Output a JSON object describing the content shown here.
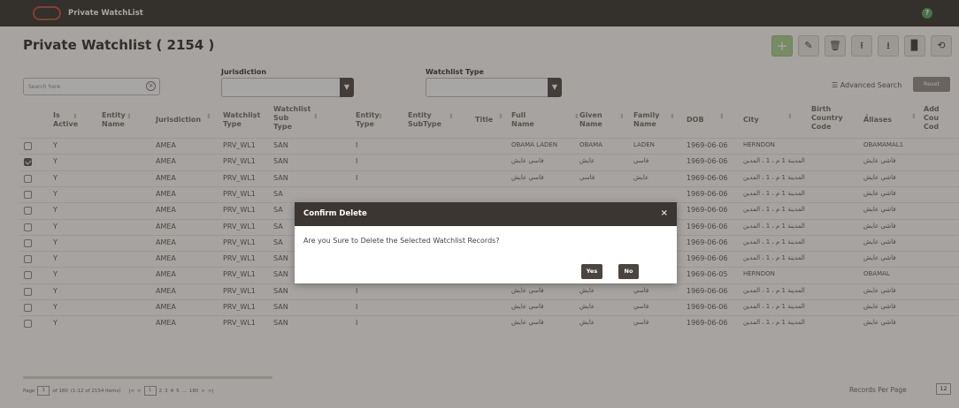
{
  "app": {
    "title": "Private WatchList",
    "help": "?"
  },
  "page": {
    "title": "Private Watchlist ( 2154 )"
  },
  "toolbar": {
    "add": "+",
    "edit": "✎",
    "delete": "🗑",
    "upload": "⭱",
    "download": "⭳",
    "file": "▉",
    "refresh": "⟲"
  },
  "filters": {
    "search_placeholder": "Search here",
    "jurisdiction_label": "Jurisdiction",
    "watchlist_type_label": "Watchlist Type",
    "advanced_search": "Advanced Search",
    "reset": "Reset"
  },
  "columns": [
    "Is Active",
    "Entity Name",
    "Jurisdiction",
    "Watchlist Type",
    "Watchlist Sub Type",
    "Entity Type",
    "Entity SubType",
    "Title",
    "Full Name",
    "Given Name",
    "Family Name",
    "DOB",
    "City",
    "Birth Country Code",
    "Aliases",
    "Add Cou Cod"
  ],
  "rows": [
    {
      "checked": false,
      "active": "Y",
      "jur": "AMEA",
      "wtype": "PRV_WL1",
      "wsub": "SAN",
      "etype": "I",
      "full": "OBAMA LADEN",
      "given": "OBAMA",
      "family": "LADEN",
      "dob": "1969-06-06",
      "city": "HERNDON",
      "alias": "OBAMAMAL1"
    },
    {
      "checked": true,
      "active": "Y",
      "jur": "AMEA",
      "wtype": "PRV_WL1",
      "wsub": "SAN",
      "etype": "I",
      "full": "فاسي عايش",
      "given": "عايش",
      "family": "فاسي",
      "dob": "1969-06-06",
      "city": "المدينة 1 م ، 1 ، المدين",
      "alias": "فاشي عايش"
    },
    {
      "checked": false,
      "active": "Y",
      "jur": "AMEA",
      "wtype": "PRV_WL1",
      "wsub": "SAN",
      "etype": "I",
      "full": "فاسي عايش",
      "given": "فاسي",
      "family": "عايش",
      "dob": "1969-06-06",
      "city": "المدينة 1 م ، 1 ، المدين",
      "alias": "فاشي عايش"
    },
    {
      "checked": false,
      "active": "Y",
      "jur": "AMEA",
      "wtype": "PRV_WL1",
      "wsub": "SA",
      "etype": "",
      "full": "",
      "given": "",
      "family": "",
      "dob": "1969-06-06",
      "city": "المدينة 1 م ، 1 ، المدين",
      "alias": "فاشي عايش"
    },
    {
      "checked": false,
      "active": "Y",
      "jur": "AMEA",
      "wtype": "PRV_WL1",
      "wsub": "SA",
      "etype": "",
      "full": "",
      "given": "",
      "family": "",
      "dob": "1969-06-06",
      "city": "المدينة 1 م ، 1 ، المدين",
      "alias": "فاشي عايش"
    },
    {
      "checked": false,
      "active": "Y",
      "jur": "AMEA",
      "wtype": "PRV_WL1",
      "wsub": "SA",
      "etype": "",
      "full": "",
      "given": "",
      "family": "",
      "dob": "1969-06-06",
      "city": "المدينة 1 م ، 1 ، المدين",
      "alias": "فاشي عايش"
    },
    {
      "checked": false,
      "active": "Y",
      "jur": "AMEA",
      "wtype": "PRV_WL1",
      "wsub": "SA",
      "etype": "",
      "full": "",
      "given": "",
      "family": "",
      "dob": "1969-06-06",
      "city": "المدينة 1 م ، 1 ، المدين",
      "alias": "فاشي عايش"
    },
    {
      "checked": false,
      "active": "Y",
      "jur": "AMEA",
      "wtype": "PRV_WL1",
      "wsub": "SAN",
      "etype": "I",
      "full": "فاسي عايش",
      "given": "عايش",
      "family": "فاسي",
      "dob": "1969-06-06",
      "city": "المدينة 1 م ، 1 ، المدين",
      "alias": "فاشي عايش"
    },
    {
      "checked": false,
      "active": "Y",
      "jur": "AMEA",
      "wtype": "PRV_WL1",
      "wsub": "SAN",
      "etype": "I",
      "full": "OBAMA LADEN",
      "given": "OBAMA",
      "family": "LADEN",
      "dob": "1969-06-05",
      "city": "HERNDON",
      "alias": "OBAMAL"
    },
    {
      "checked": false,
      "active": "Y",
      "jur": "AMEA",
      "wtype": "PRV_WL1",
      "wsub": "SAN",
      "etype": "I",
      "full": "فاسي عايش",
      "given": "عايش",
      "family": "فاسي",
      "dob": "1969-06-06",
      "city": "المدينة 1 م ، 1 ، المدين",
      "alias": "فاشي عايش"
    },
    {
      "checked": false,
      "active": "Y",
      "jur": "AMEA",
      "wtype": "PRV_WL1",
      "wsub": "SAN",
      "etype": "I",
      "full": "فاسي عايش",
      "given": "عايش",
      "family": "فاسي",
      "dob": "1969-06-06",
      "city": "المدينة 1 م ، 1 ، المدين",
      "alias": "فاشي عايش"
    },
    {
      "checked": false,
      "active": "Y",
      "jur": "AMEA",
      "wtype": "PRV_WL1",
      "wsub": "SAN",
      "etype": "I",
      "full": "فاسي عايش",
      "given": "عايش",
      "family": "فاسي",
      "dob": "1969-06-06",
      "city": "المدينة 1 م ، 1 ، المدين",
      "alias": "فاشي عايش"
    }
  ],
  "pagination": {
    "page_label": "Page",
    "current": "1",
    "of_text": "of 180",
    "range": "(1-12 of 2154 items)",
    "first": "|<",
    "prev": "<",
    "pages": [
      "1",
      "2",
      "3",
      "4",
      "5",
      "...",
      "180"
    ],
    "next": ">",
    "last": ">|",
    "records_per_page_label": "Records Per Page",
    "records_per_page": "12"
  },
  "dialog": {
    "title": "Confirm Delete",
    "close": "×",
    "message": "Are you Sure to Delete the Selected Watchlist Records?",
    "yes": "Yes",
    "no": "No"
  }
}
